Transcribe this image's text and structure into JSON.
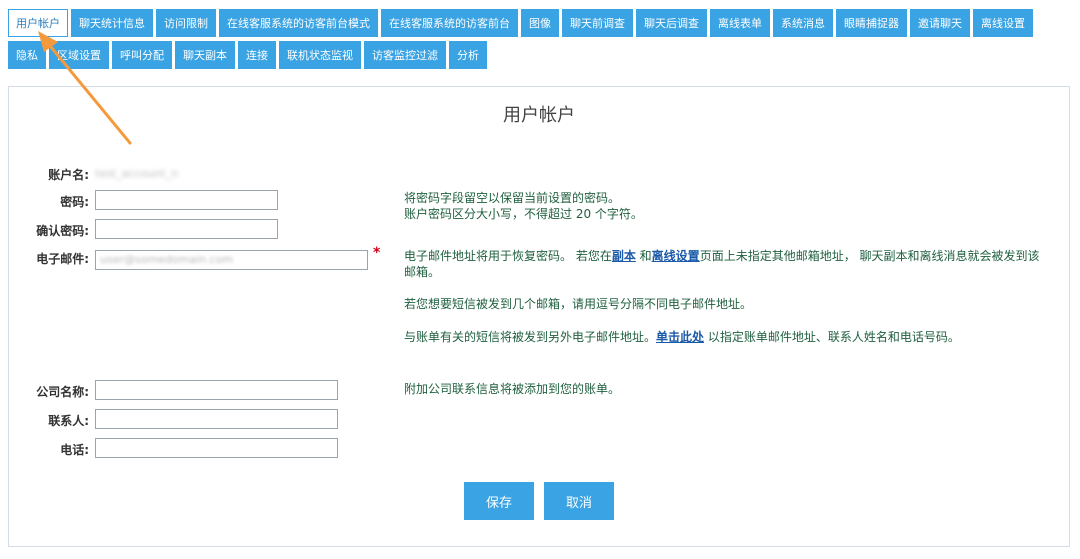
{
  "tabs": [
    {
      "label": "用户帐户",
      "active": true
    },
    {
      "label": "聊天统计信息"
    },
    {
      "label": "访问限制"
    },
    {
      "label": "在线客服系统的访客前台模式"
    },
    {
      "label": "在线客服系统的访客前台"
    },
    {
      "label": "图像"
    },
    {
      "label": "聊天前调查"
    },
    {
      "label": "聊天后调查"
    },
    {
      "label": "离线表单"
    },
    {
      "label": "系统消息"
    },
    {
      "label": "眼睛捕捉器"
    },
    {
      "label": "邀请聊天"
    },
    {
      "label": "离线设置"
    },
    {
      "label": "隐私"
    },
    {
      "label": "区域设置"
    },
    {
      "label": "呼叫分配"
    },
    {
      "label": "聊天副本"
    },
    {
      "label": "连接"
    },
    {
      "label": "联机状态监视"
    },
    {
      "label": "访客监控过滤"
    },
    {
      "label": "分析"
    }
  ],
  "page": {
    "title": "用户帐户"
  },
  "form": {
    "account_label": "账户名:",
    "account_value": "test_account_n",
    "password_label": "密码:",
    "password_value": "",
    "confirm_label": "确认密码:",
    "confirm_value": "",
    "email_label": "电子邮件:",
    "email_value": "user@somedomain.com",
    "required_mark": "*",
    "company_label": "公司名称:",
    "company_value": "",
    "contact_label": "联系人:",
    "contact_value": "",
    "phone_label": "电话:",
    "phone_value": ""
  },
  "help": {
    "password_line1": "将密码字段留空以保留当前设置的密码。",
    "password_line2": "账户密码区分大小写，不得超过 20 个字符。",
    "email_pre": "电子邮件地址将用于恢复密码。 若您在",
    "email_link1": "副本",
    "email_mid": " 和",
    "email_link2": "离线设置",
    "email_post": "页面上未指定其他邮箱地址， 聊天副本和离线消息就会被发到该邮箱。",
    "email_multi": "若您想要短信被发到几个邮箱，请用逗号分隔不同电子邮件地址。",
    "billing_pre": "与账单有关的短信将被发到另外电子邮件地址。",
    "billing_link": "单击此处",
    "billing_post": " 以指定账单邮件地址、联系人姓名和电话号码。",
    "company_note": "附加公司联系信息将被添加到您的账单。"
  },
  "buttons": {
    "save": "保存",
    "cancel": "取消"
  },
  "colors": {
    "accent": "#3aa3e3",
    "arrow": "#f59a3c",
    "required": "#d0021b"
  }
}
